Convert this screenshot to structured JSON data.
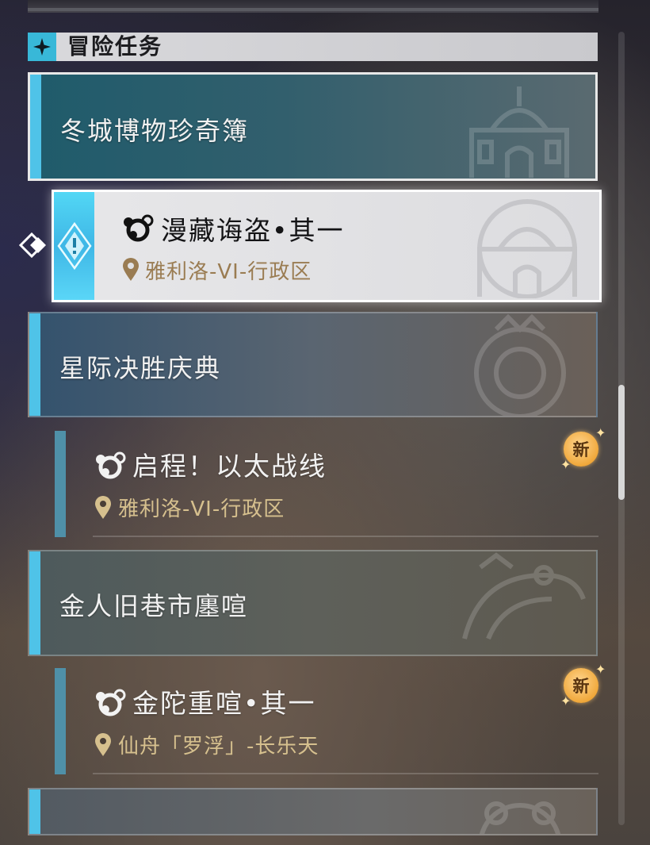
{
  "section": {
    "title": "冒险任务"
  },
  "categories": [
    {
      "title": "冬城博物珍奇簿"
    },
    {
      "title": "星际决胜庆典"
    },
    {
      "title": "金人旧巷市廛喧"
    },
    {
      "title": ""
    }
  ],
  "quests": [
    {
      "title": "漫藏诲盗•其一",
      "location": "雅利洛-VI-行政区",
      "selected": true,
      "is_new": false
    },
    {
      "title": "启程！以太战线",
      "location": "雅利洛-VI-行政区",
      "selected": false,
      "is_new": true,
      "badge": "新"
    },
    {
      "title": "金陀重喧•其一",
      "location": "仙舟「罗浮」-长乐天",
      "selected": false,
      "is_new": true,
      "badge": "新"
    }
  ],
  "colors": {
    "accent": "#4fc3e8",
    "location_text": "#d6c08e",
    "new_badge": "#f0a83b"
  },
  "icons": [
    "adventure-quest-icon",
    "location-pin-icon",
    "quest-type-icon",
    "new-badge-icon",
    "selection-pointer-icon"
  ]
}
